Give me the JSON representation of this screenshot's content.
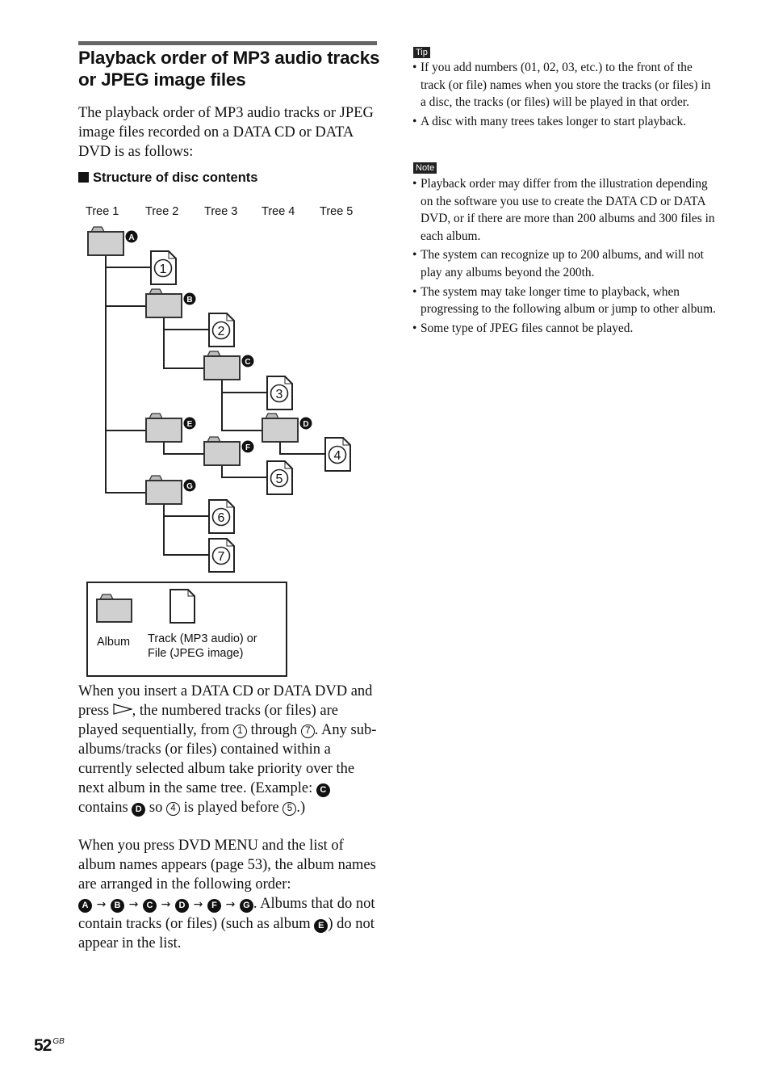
{
  "section": {
    "title": "Playback order of MP3 audio tracks or JPEG image files",
    "intro": "The playback order of MP3 audio tracks or JPEG image files recorded on a DATA CD or DATA DVD is as follows:",
    "subheading": "Structure of disc contents"
  },
  "diagram": {
    "tree_labels": [
      "Tree 1",
      "Tree 2",
      "Tree 3",
      "Tree 4",
      "Tree 5"
    ],
    "albums": [
      {
        "id": "A",
        "tree": 1
      },
      {
        "id": "B",
        "tree": 2,
        "parent": "A"
      },
      {
        "id": "C",
        "tree": 3,
        "parent": "B"
      },
      {
        "id": "D",
        "tree": 4,
        "parent": "C"
      },
      {
        "id": "E",
        "tree": 2,
        "parent": "A"
      },
      {
        "id": "F",
        "tree": 3,
        "parent": "E"
      },
      {
        "id": "G",
        "tree": 2,
        "parent": "A"
      }
    ],
    "tracks": [
      {
        "num": "1",
        "album": "A"
      },
      {
        "num": "2",
        "album": "B"
      },
      {
        "num": "3",
        "album": "C"
      },
      {
        "num": "4",
        "album": "D"
      },
      {
        "num": "5",
        "album": "F"
      },
      {
        "num": "6",
        "album": "G"
      },
      {
        "num": "7",
        "album": "G"
      }
    ],
    "legend": {
      "album_label": "Album",
      "track_label_line1": "Track (MP3 audio) or",
      "track_label_line2": "File (JPEG image)"
    }
  },
  "paragraph1": {
    "t1": "When you insert a DATA CD or DATA DVD and press",
    "t2": ", the numbered tracks (or files) are played sequentially, from",
    "n1": "1",
    "t3": "through",
    "n2": "7",
    "t4": ". Any sub-albums/tracks (or files) contained within a currently selected album take priority over the next album in the same tree. (Example:",
    "l1": "C",
    "t5": "contains",
    "l2": "D",
    "t6": "so",
    "n3": "4",
    "t7": "is played before",
    "n4": "5",
    "t8": ".)"
  },
  "paragraph2": {
    "t1": "When you press DVD MENU and the list of album names appears (page 53), the album names are arranged in the following order:",
    "order": [
      "A",
      "B",
      "C",
      "D",
      "F",
      "G"
    ],
    "arrow": "→",
    "t2": ". Albums that do not contain tracks (or files) (such as album",
    "l1": "E",
    "t3": ") do not appear in the list."
  },
  "tip": {
    "label": "Tip",
    "items": [
      "If you add numbers (01, 02, 03, etc.) to the front of the track (or file) names when you store the tracks (or files) in a disc, the tracks (or files) will be played in that order.",
      "A disc with many trees takes longer to start playback."
    ]
  },
  "note": {
    "label": "Note",
    "items": [
      "Playback order may differ from the illustration depending on the software you use to create the DATA CD or DATA DVD, or if there are more than 200 albums and 300 files in each album.",
      "The system can recognize up to 200 albums, and will not play any albums beyond the 200th.",
      "The system may take longer time to playback, when progressing to the following album or jump to other album.",
      "Some type of JPEG files cannot be played."
    ]
  },
  "footer": {
    "page_number": "52",
    "page_suffix": "GB"
  }
}
